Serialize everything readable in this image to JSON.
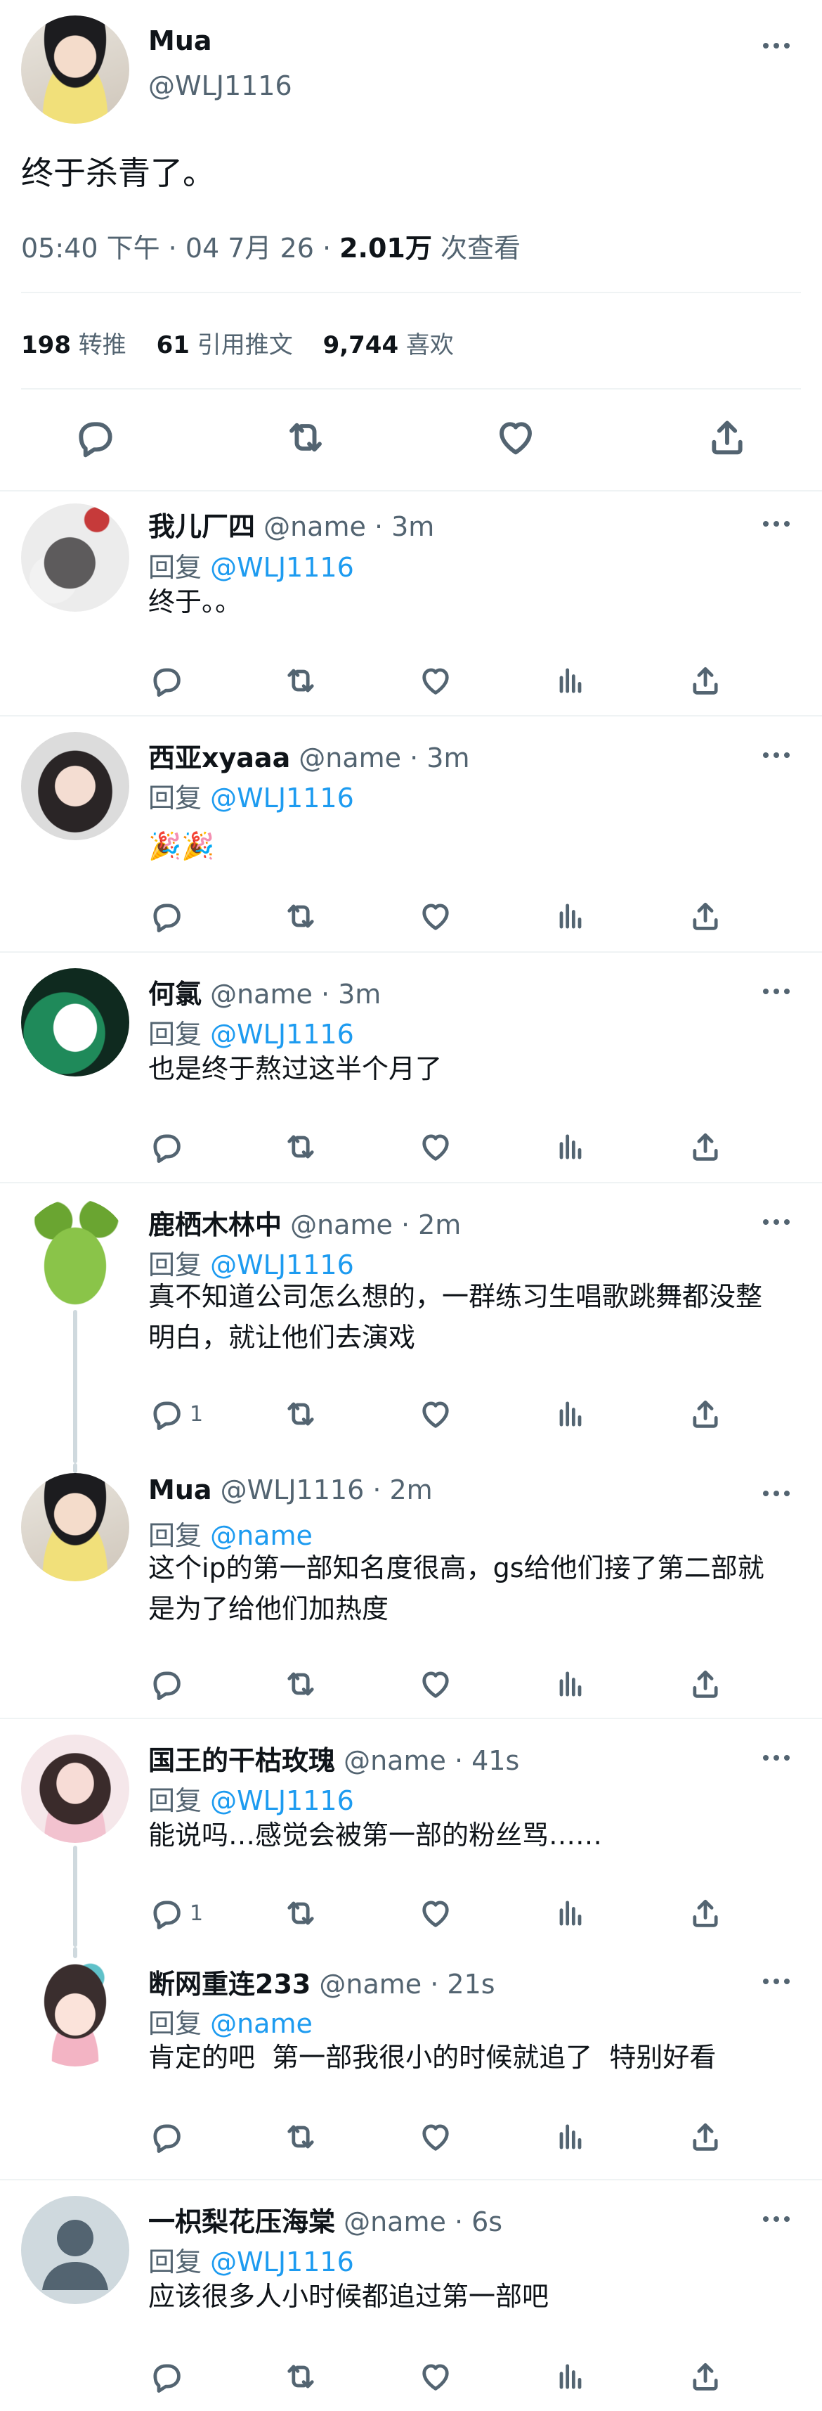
{
  "main_tweet": {
    "author_name": "Mua",
    "author_handle": "@WLJ1116",
    "text": "终于杀青了。",
    "time": "05:40 下午 · 04 7月 26 · ",
    "views_count": "2.01万",
    "views_label": " 次查看",
    "stats": {
      "retweets_count": "198",
      "retweets_label": "转推",
      "quotes_count": "61",
      "quotes_label": "引用推文",
      "likes_count": "9,744",
      "likes_label": "喜欢"
    }
  },
  "replies": [
    {
      "name": "我儿厂四",
      "meta": " @name · 3m",
      "reply_prefix": "回复 ",
      "reply_to": "@WLJ1116",
      "text": "终于。。",
      "reply_count": ""
    },
    {
      "name": "西亚xyaaa",
      "meta": " @name · 3m",
      "reply_prefix": "回复 ",
      "reply_to": "@WLJ1116",
      "text": "🎉🎉",
      "reply_count": ""
    },
    {
      "name": "何氯",
      "meta": " @name · 3m",
      "reply_prefix": "回复 ",
      "reply_to": "@WLJ1116",
      "text": "也是终于熬过这半个月了",
      "reply_count": ""
    },
    {
      "name": "鹿栖木林中",
      "meta": " @name · 2m",
      "reply_prefix": "回复 ",
      "reply_to": "@WLJ1116",
      "text": "真不知道公司怎么想的，一群练习生唱歌跳舞都没整明白，就让他们去演戏",
      "reply_count": "1"
    },
    {
      "name": "Mua",
      "meta": " @WLJ1116 · 2m",
      "reply_prefix": "回复 ",
      "reply_to": "@name",
      "text": "这个ip的第一部知名度很高，gs给他们接了第二部就是为了给他们加热度",
      "reply_count": ""
    },
    {
      "name": "国王的干枯玫瑰",
      "meta": " @name · 41s",
      "reply_prefix": "回复 ",
      "reply_to": "@WLJ1116",
      "text": "能说吗…感觉会被第一部的粉丝骂……",
      "reply_count": "1"
    },
    {
      "name": "断网重连233",
      "meta": " @name · 21s",
      "reply_prefix": "回复 ",
      "reply_to": "@name",
      "text": "肯定的吧  第一部我很小的时候就追了  特别好看",
      "reply_count": ""
    },
    {
      "name": "一枳梨花压海棠",
      "meta": " @name · 6s",
      "reply_prefix": "回复 ",
      "reply_to": "@WLJ1116",
      "text": "应该很多人小时候都追过第一部吧",
      "reply_count": ""
    }
  ],
  "icons": {
    "more": "more-icon",
    "reply": "reply-icon",
    "retweet": "retweet-icon",
    "like": "like-icon",
    "views": "views-icon",
    "share": "share-icon"
  },
  "colors": {
    "text": "#0f1419",
    "secondary": "#536471",
    "accent": "#1d9bf0",
    "divider": "#eff3f4"
  }
}
